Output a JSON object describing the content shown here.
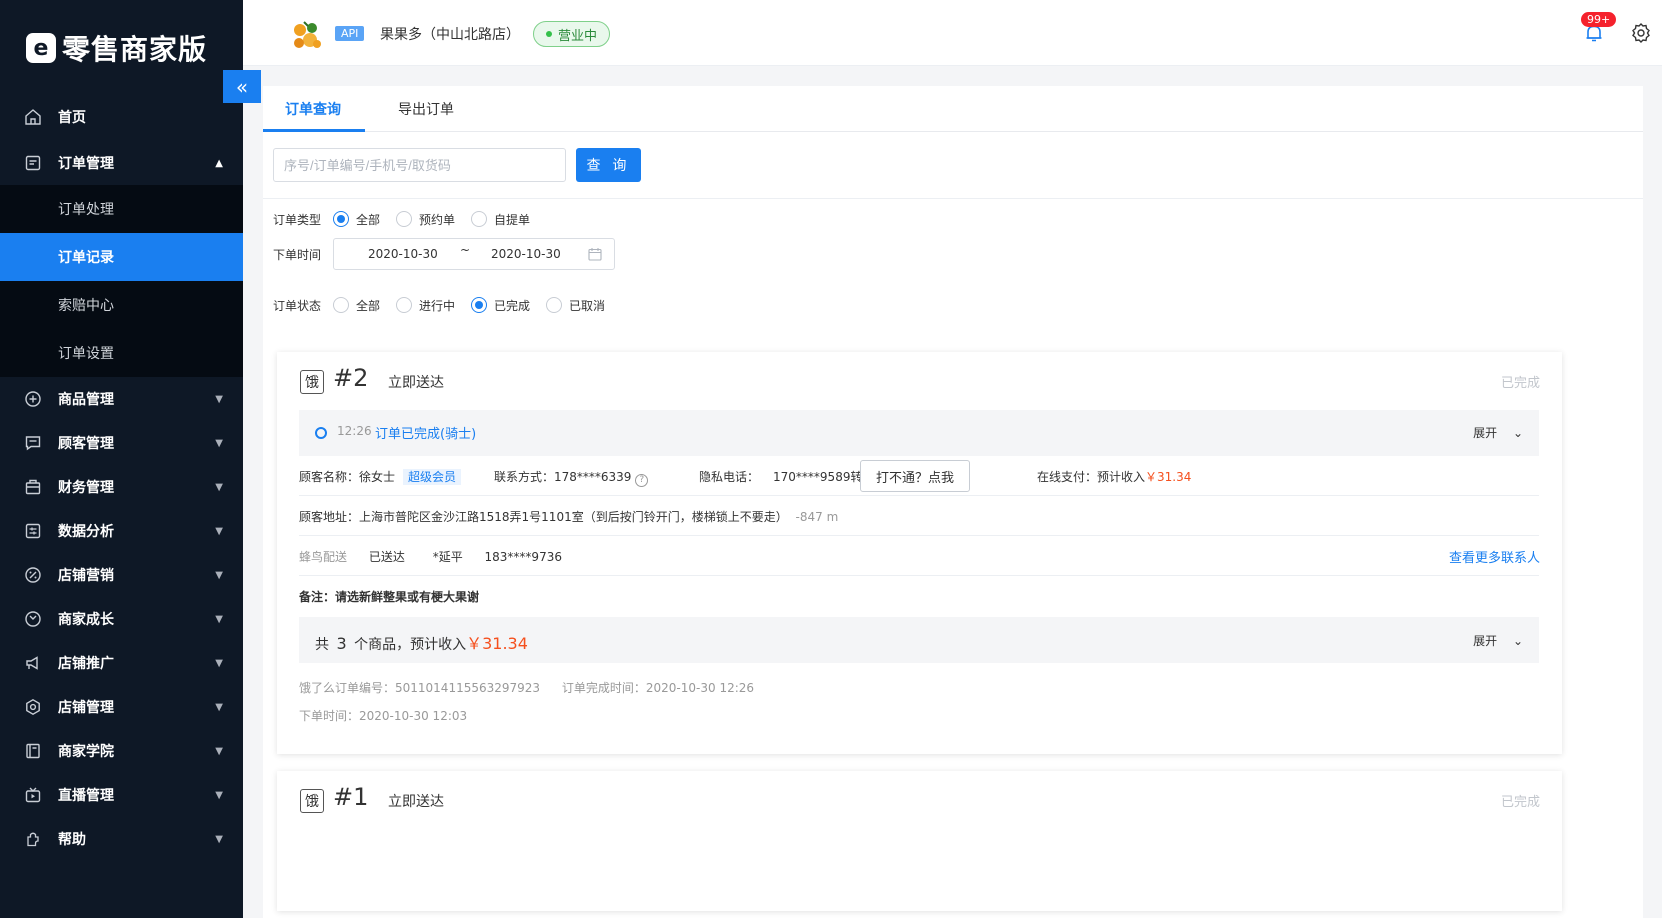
{
  "app": {
    "logo_glyph": "e",
    "title": "零售商家版"
  },
  "sidebar": {
    "items": [
      {
        "label": "首页",
        "icon": "home-icon"
      },
      {
        "label": "订单管理",
        "icon": "order-icon",
        "expanded": true,
        "children": [
          {
            "label": "订单处理"
          },
          {
            "label": "订单记录",
            "active": true
          },
          {
            "label": "索赔中心"
          },
          {
            "label": "订单设置"
          }
        ]
      },
      {
        "label": "商品管理",
        "icon": "goods-icon"
      },
      {
        "label": "顾客管理",
        "icon": "customer-icon"
      },
      {
        "label": "财务管理",
        "icon": "finance-icon"
      },
      {
        "label": "数据分析",
        "icon": "analytics-icon"
      },
      {
        "label": "店铺营销",
        "icon": "marketing-icon"
      },
      {
        "label": "商家成长",
        "icon": "growth-icon"
      },
      {
        "label": "店铺推广",
        "icon": "promotion-icon"
      },
      {
        "label": "店铺管理",
        "icon": "store-settings-icon"
      },
      {
        "label": "商家学院",
        "icon": "academy-icon"
      },
      {
        "label": "直播管理",
        "icon": "live-icon"
      },
      {
        "label": "帮助",
        "icon": "help-icon"
      }
    ]
  },
  "header": {
    "api_tag": "API",
    "store_name": "果果多（中山北路店）",
    "status": "营业中",
    "notification_badge": "99+"
  },
  "tabs": {
    "query": "订单查询",
    "export": "导出订单"
  },
  "search": {
    "placeholder": "序号/订单编号/手机号/取货码",
    "button": "查 询"
  },
  "filters": {
    "type_label": "订单类型",
    "type_options": [
      "全部",
      "预约单",
      "自提单"
    ],
    "type_selected": "全部",
    "time_label": "下单时间",
    "date_start": "2020-10-30",
    "date_sep": "~",
    "date_end": "2020-10-30",
    "status_label": "订单状态",
    "status_options": [
      "全部",
      "进行中",
      "已完成",
      "已取消"
    ],
    "status_selected": "已完成"
  },
  "orders": [
    {
      "platform_icon": "饿",
      "number": "#2",
      "delivery_type": "立即送达",
      "status": "已完成",
      "timeline_time": "12:26",
      "timeline_text": "订单已完成(骑士)",
      "expand_label": "展开",
      "customer_label": "顾客名称：徐女士",
      "member_tag": "超级会员",
      "contact_label": "联系方式：178****6339",
      "privacy_label": "隐私电话：",
      "privacy_phone": "170****9589转617",
      "call_button": "打不通？点我",
      "payment_label": "在线支付：预计收入",
      "payment_amount": "￥31.34",
      "address": "顾客地址：上海市普陀区金沙江路1518弄1号1101室（到后按门铃开门，楼梯锁上不要走）",
      "distance": "-847 m",
      "courier_company": "蜂鸟配送",
      "courier_status": "已送达",
      "courier_name": "*延平",
      "courier_phone": "183****9736",
      "more_contacts": "查看更多联系人",
      "note": "备注：请选新鲜整果或有梗大果谢",
      "goods_prefix": "共",
      "goods_count": "3",
      "goods_mid": "个商品，预计收入",
      "goods_amount": "￥31.34",
      "goods_expand": "展开",
      "order_id_label": "饿了么订单编号：5011014115563297923",
      "complete_time": "订单完成时间：2020-10-30 12:26",
      "order_time": "下单时间：2020-10-30 12:03"
    },
    {
      "platform_icon": "饿",
      "number": "#1",
      "delivery_type": "立即送达",
      "status": "已完成"
    }
  ]
}
